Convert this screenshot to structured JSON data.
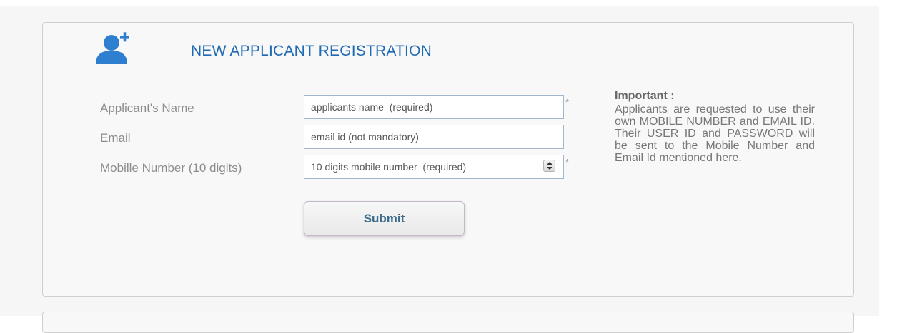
{
  "form": {
    "title": "NEW APPLICANT REGISTRATION",
    "fields": [
      {
        "label": "Applicant's Name",
        "placeholder": "applicants name  (required)",
        "required_mark": "*"
      },
      {
        "label": "Email",
        "placeholder": "email id (not mandatory)"
      },
      {
        "label": "Mobille Number (10 digits)",
        "placeholder": "10 digits mobile number  (required)",
        "required_mark": "*"
      }
    ],
    "submit_label": "Submit"
  },
  "notice": {
    "title": "Important :",
    "body": "Applicants are requested to use their own MOBILE NUMBER and EMAIL ID. Their USER ID and PASSWORD will be sent to the Mobile Number and Email Id mentioned here."
  },
  "icons": {
    "header_icon": "add-user-icon",
    "spinner_icon": "number-spinner-icon"
  },
  "colors": {
    "title": "#1f6ab3",
    "icon": "#2f7fd0",
    "label": "#8d8d8d",
    "input_border": "#9fb6cc",
    "button_text": "#3d6c8c",
    "top_fragment": "#e03030"
  }
}
